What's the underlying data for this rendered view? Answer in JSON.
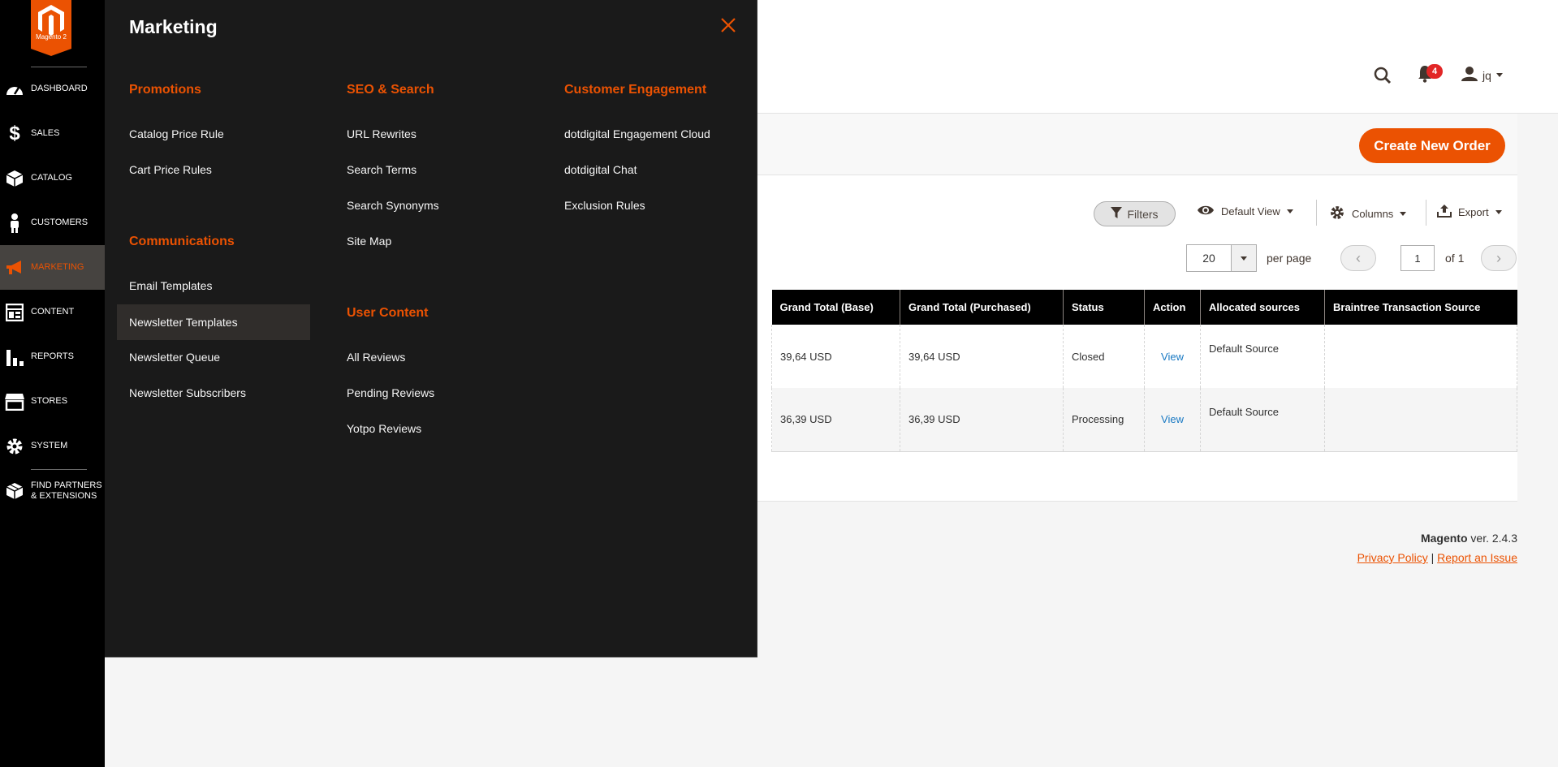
{
  "brand": {
    "logo_text": "Magento 2",
    "accent": "#eb5202"
  },
  "nav": {
    "items": [
      {
        "label": "DASHBOARD",
        "icon": "speedometer-icon"
      },
      {
        "label": "SALES",
        "icon": "dollar-icon"
      },
      {
        "label": "CATALOG",
        "icon": "box-icon"
      },
      {
        "label": "CUSTOMERS",
        "icon": "person-icon"
      },
      {
        "label": "MARKETING",
        "icon": "megaphone-icon",
        "active": true
      },
      {
        "label": "CONTENT",
        "icon": "layout-icon"
      },
      {
        "label": "REPORTS",
        "icon": "bar-chart-icon"
      },
      {
        "label": "STORES",
        "icon": "storefront-icon"
      },
      {
        "label": "SYSTEM",
        "icon": "gear-icon"
      },
      {
        "label_line1": "FIND PARTNERS",
        "label_line2": "& EXTENSIONS",
        "icon": "cubes-icon"
      }
    ]
  },
  "header": {
    "notification_count": "4",
    "user_name": "jq"
  },
  "actions": {
    "create_new_order": "Create New Order"
  },
  "toolbar": {
    "filters": "Filters",
    "default_view": "Default View",
    "columns": "Columns",
    "export": "Export",
    "per_page_value": "20",
    "per_page_label": "per page",
    "page_current": "1",
    "page_of": "of 1"
  },
  "grid": {
    "columns": [
      "Grand Total (Base)",
      "Grand Total (Purchased)",
      "Status",
      "Action",
      "Allocated sources",
      "Braintree Transaction Source"
    ],
    "rows": [
      {
        "base": "39,64 USD",
        "purchased": "39,64 USD",
        "status": "Closed",
        "action": "View",
        "sources": "Default Source",
        "braintree": ""
      },
      {
        "base": "36,39 USD",
        "purchased": "36,39 USD",
        "status": "Processing",
        "action": "View",
        "sources": "Default Source",
        "braintree": ""
      }
    ]
  },
  "footer": {
    "product": "Magento",
    "version": " ver. 2.4.3",
    "privacy": "Privacy Policy",
    "separator": " | ",
    "report": "Report an Issue"
  },
  "flyout": {
    "title": "Marketing",
    "groups": {
      "promotions": {
        "title": "Promotions",
        "links": [
          "Catalog Price Rule",
          "Cart Price Rules"
        ]
      },
      "communications": {
        "title": "Communications",
        "links": [
          "Email Templates",
          "Newsletter Templates",
          "Newsletter Queue",
          "Newsletter Subscribers"
        ]
      },
      "seo": {
        "title": "SEO & Search",
        "links": [
          "URL Rewrites",
          "Search Terms",
          "Search Synonyms",
          "Site Map"
        ]
      },
      "user_content": {
        "title": "User Content",
        "links": [
          "All Reviews",
          "Pending Reviews",
          "Yotpo Reviews"
        ]
      },
      "engagement": {
        "title": "Customer Engagement",
        "links": [
          "dotdigital Engagement Cloud",
          "dotdigital Chat",
          "Exclusion Rules"
        ]
      }
    }
  }
}
